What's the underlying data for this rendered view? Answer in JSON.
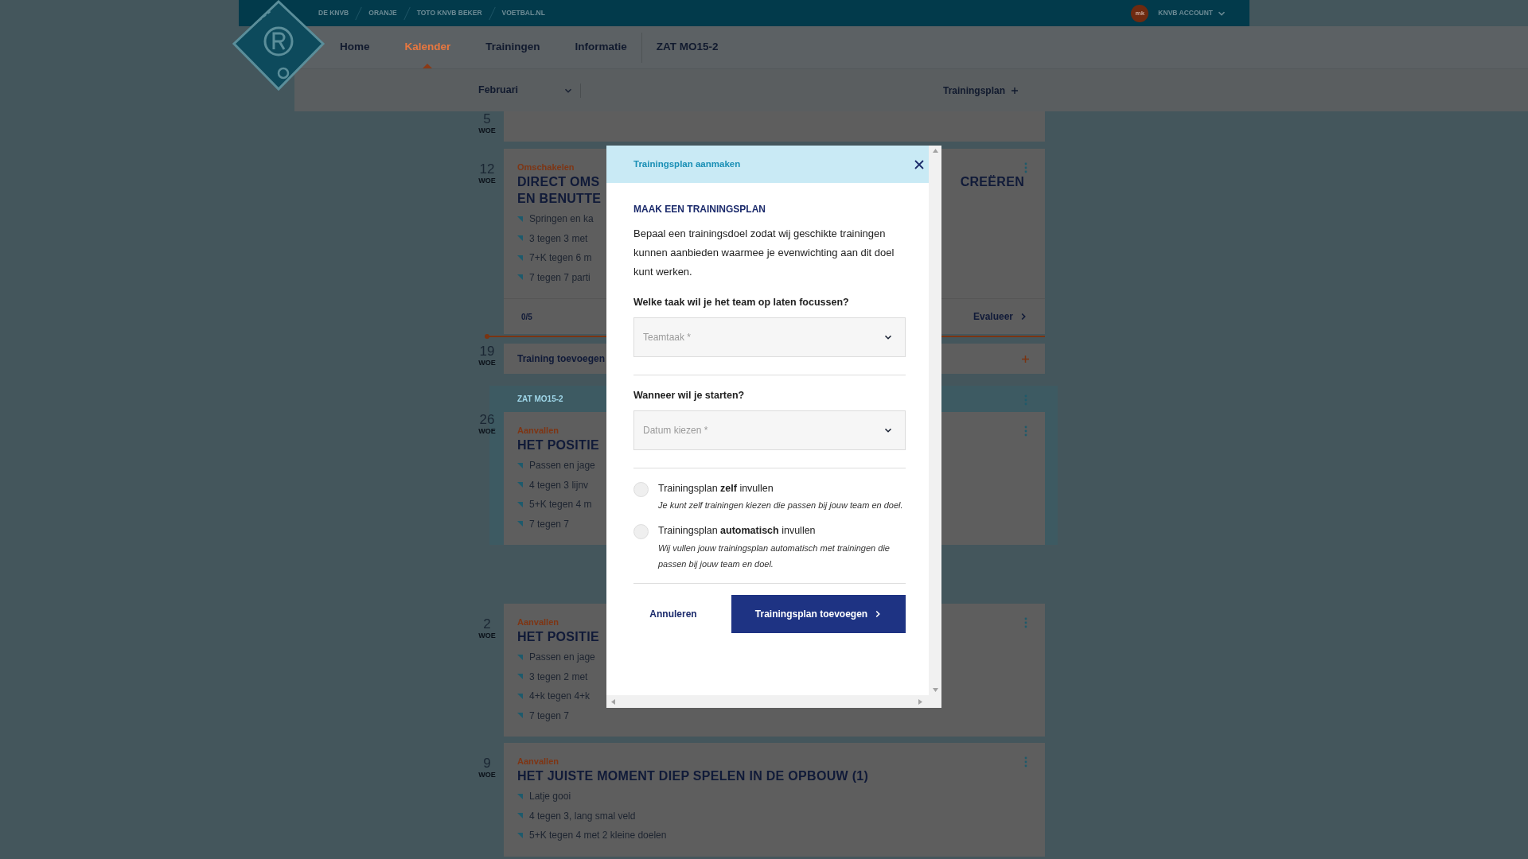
{
  "top_links": [
    "DE KNVB",
    "ORANJE",
    "TOTO KNVB BEKER",
    "VOETBAL.NL"
  ],
  "account": {
    "initials": "mk",
    "label": "KNVB ACCOUNT"
  },
  "nav": [
    {
      "label": "Home",
      "selected": false
    },
    {
      "label": "Kalender",
      "selected": true
    },
    {
      "label": "Trainingen",
      "selected": false
    },
    {
      "label": "Informatie",
      "selected": false
    }
  ],
  "team": "ZAT MO15-2",
  "month": "Februari",
  "plan_button": "Trainingsplan",
  "calendar": [
    {
      "kind": "empty",
      "day": "5",
      "weekday": "WOE"
    },
    {
      "kind": "training",
      "day": "12",
      "weekday": "WOE",
      "category": "Omschakelen",
      "title_lines": [
        "DIRECT OMS",
        "EN BENUTTE"
      ],
      "title_right": "CREËREN",
      "items": [
        "Springen en ka",
        "3 tegen 3 met",
        "7+K tegen 6 m",
        "7 tegen 7 parti"
      ],
      "footer": {
        "score": "0/5",
        "action": "Evalueer"
      }
    },
    {
      "kind": "today"
    },
    {
      "kind": "add",
      "day": "19",
      "weekday": "WOE",
      "label": "Training toevoegen"
    },
    {
      "kind": "team",
      "label": "ZAT MO15-2",
      "entries": [
        {
          "kind": "training",
          "day": "26",
          "weekday": "WOE",
          "category": "Aanvallen",
          "title_lines": [
            "HET POSITIE"
          ],
          "items": [
            "Passen en jage",
            "4 tegen 3 lijnv",
            "5+K tegen 4 m",
            "7 tegen 7"
          ]
        }
      ]
    },
    {
      "kind": "training",
      "day": "2",
      "weekday": "WOE",
      "category": "Aanvallen",
      "title_lines": [
        "HET POSITIE"
      ],
      "items": [
        "Passen en jage",
        "3 tegen 2 met",
        "4+k tegen 4+k",
        "7 tegen 7"
      ]
    },
    {
      "kind": "training",
      "day": "9",
      "weekday": "WOE",
      "category": "Aanvallen",
      "title_lines": [
        "HET JUISTE MOMENT DIEP SPELEN IN DE OPBOUW (1)"
      ],
      "items": [
        "Latje gooi",
        "4 tegen 3, lang smal veld",
        "5+K tegen 4 met 2 kleine doelen"
      ]
    }
  ],
  "modal": {
    "title": "Trainingsplan aanmaken",
    "heading": "MAAK EEN TRAININGSPLAN",
    "description": "Bepaal een trainingsdoel zodat wij geschikte trainingen kunnen aanbieden waarmee je evenwichting aan dit doel kunt werken.",
    "questions": [
      {
        "label": "Welke taak wil je het team op laten focussen?",
        "placeholder": "Teamtaak *"
      },
      {
        "label": "Wanneer wil je starten?",
        "placeholder": "Datum kiezen *"
      }
    ],
    "options": [
      {
        "label": "Trainingsplan **zelf** invullen",
        "description": "Je kunt zelf trainingen kiezen die passen bij jouw team en doel.",
        "selected": false
      },
      {
        "label": "Trainingsplan **automatisch** invullen",
        "description": "Wij vullen jouw trainingsplan automatisch met trainingen die passen bij jouw team en doel.",
        "selected": false
      }
    ],
    "cancel": "Annuleren",
    "submit": "Trainingsplan toevoegen"
  }
}
